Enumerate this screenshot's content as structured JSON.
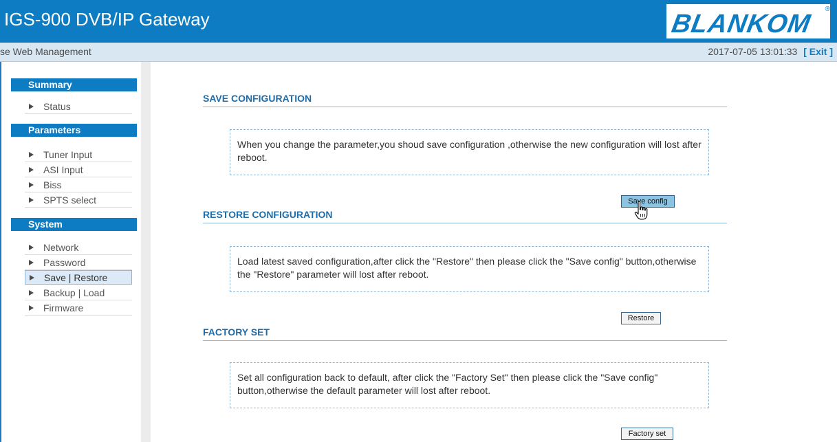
{
  "header": {
    "title": "IGS-900 DVB/IP Gateway",
    "logo_text": "BLANKOM",
    "logo_reg": "®"
  },
  "subbar": {
    "title": "se Web Management",
    "datetime": "2017-07-05 13:01:33",
    "exit_label": "[ Exit ]"
  },
  "sidebar": {
    "sections": [
      {
        "title": "Summary",
        "items": [
          "Status"
        ]
      },
      {
        "title": "Parameters",
        "items": [
          "Tuner Input",
          "ASI Input",
          "Biss",
          "SPTS select"
        ]
      },
      {
        "title": "System",
        "items": [
          "Network",
          "Password",
          "Save | Restore",
          "Backup | Load",
          "Firmware"
        ]
      }
    ],
    "active_item": "Save | Restore"
  },
  "main": {
    "save": {
      "heading": "SAVE CONFIGURATION",
      "text": "When you change the parameter,you shoud save configuration ,otherwise the new configuration will lost after reboot.",
      "button": "Save config"
    },
    "restore": {
      "heading": "RESTORE CONFIGURATION",
      "text": "Load latest saved configuration,after click the \"Restore\" then please click the \"Save config\" button,otherwise the \"Restore\" parameter will lost after reboot.",
      "button": "Restore"
    },
    "factory": {
      "heading": "FACTORY SET",
      "text": "Set all configuration back to default, after click the \"Factory Set\" then please click the \"Save config\" button,otherwise the default parameter will lost after reboot.",
      "button": "Factory set"
    }
  },
  "colors": {
    "brand": "#0e7cc3",
    "subbar": "#d9e7f2",
    "heading": "#1f6ca8"
  }
}
